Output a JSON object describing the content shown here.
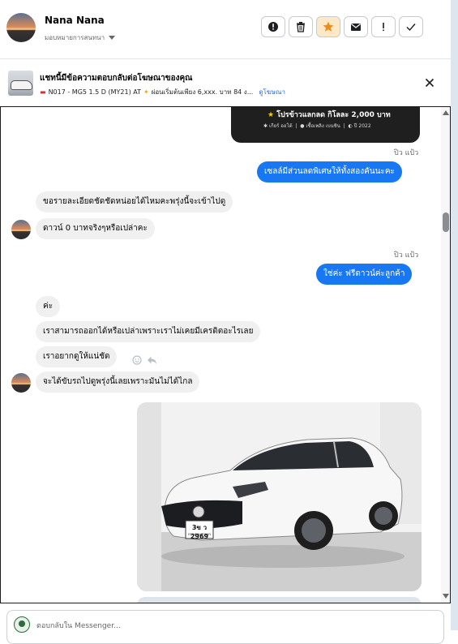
{
  "header": {
    "name": "Nana Nana",
    "assign_label": "มอบหมายการสนทนา",
    "actions": [
      {
        "icon": "alert-circle-icon",
        "name": "mark-spam-button"
      },
      {
        "icon": "trash-icon",
        "name": "delete-button"
      },
      {
        "icon": "star-icon",
        "name": "star-button",
        "active": true
      },
      {
        "icon": "mail-icon",
        "name": "mark-unread-button"
      },
      {
        "icon": "exclamation-icon",
        "name": "follow-up-button"
      },
      {
        "icon": "check-icon",
        "name": "done-button"
      }
    ]
  },
  "ad_reply": {
    "title": "แชทนี้มีข้อความตอบกลับต่อโฆษณาของคุณ",
    "subtitle": "N017 - MG5 1.5 D (MY21) AT",
    "subtitle_more": "ผ่อนเริ่มต้นเพียง 6,xxx. บาท 84 ง...",
    "link": "ดูโฆษณา"
  },
  "promo_card": {
    "line1": "โปรข้าวแลกลด กิโลละ 2,000 บาท",
    "gear": "เกียร์ ออโต้",
    "fuel": "เชื้อเพลิง เบนซิน",
    "year": "ปี 2022"
  },
  "messages": [
    {
      "type": "seen",
      "text": "ปิว แป้ว"
    },
    {
      "type": "out",
      "text": "เซลล์มีส่วนลดพิเศษให้ทั้งสองคันนะคะ"
    },
    {
      "type": "in",
      "text": "ขอรายละเอียดชัดชัดหน่อยได้ไหมคะพรุ่งนี้จะเข้าไปดู"
    },
    {
      "type": "in",
      "text": "ดาวน์ 0 บาทจริงๆหรือเปล่าคะ"
    },
    {
      "type": "seen",
      "text": "ปิว แป้ว"
    },
    {
      "type": "out",
      "text": "ใช่ค่ะ  ฟรีดาวน์ค่ะลูกค้า"
    },
    {
      "type": "in",
      "text": "ค่ะ"
    },
    {
      "type": "in",
      "text": "เราสามารถออกได้หรือเปล่าเพราะเราไม่เคยมีเครดิตอะไรเลย"
    },
    {
      "type": "in",
      "text": "เราอยากดูให้แน่ชัด"
    },
    {
      "type": "in",
      "text": "จะได้ขับรถไปดูพรุ่งนี้เลยเพราะมันไม่ได้ไกล"
    }
  ],
  "photo": {
    "plate": "3ข ว 2969",
    "plate_sub": "กรุงเทพมหานคร"
  },
  "composer": {
    "placeholder": "ตอบกลับใน Messenger..."
  }
}
